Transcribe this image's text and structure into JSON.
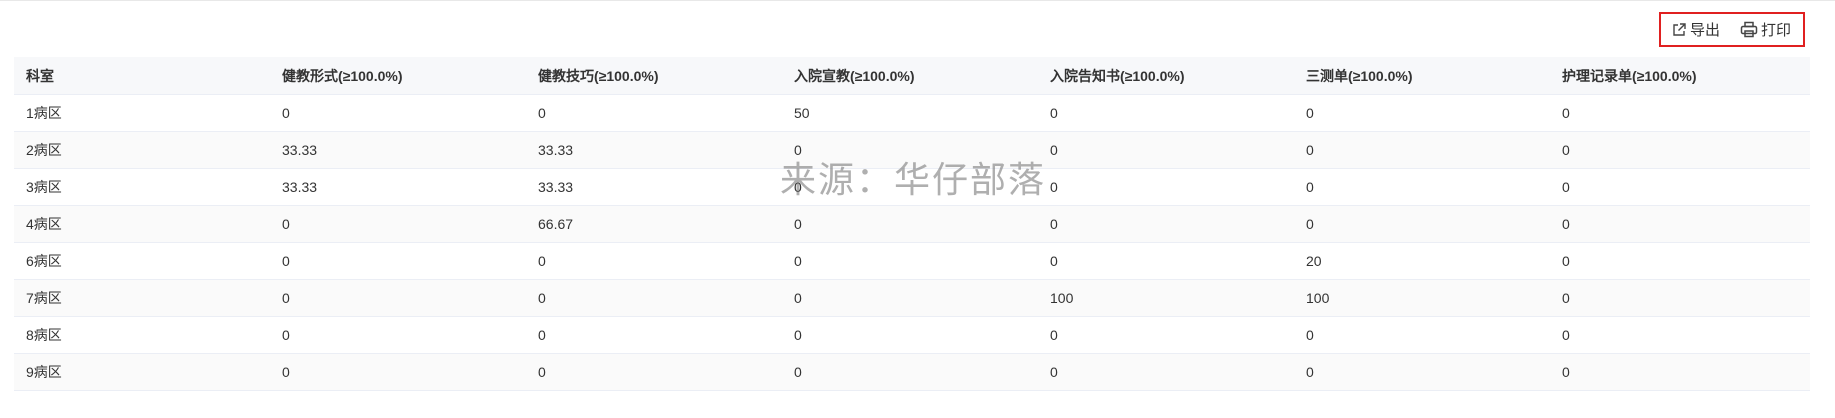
{
  "toolbar": {
    "export_label": "导出",
    "print_label": "打印",
    "export_icon": "external-link-icon",
    "print_icon": "printer-icon",
    "highlight_color": "#e02020"
  },
  "table": {
    "columns": [
      "科室",
      "健教形式(≥100.0%)",
      "健教技巧(≥100.0%)",
      "入院宣教(≥100.0%)",
      "入院告知书(≥100.0%)",
      "三测单(≥100.0%)",
      "护理记录单(≥100.0%)"
    ],
    "rows": [
      [
        "1病区",
        "0",
        "0",
        "50",
        "0",
        "0",
        "0"
      ],
      [
        "2病区",
        "33.33",
        "33.33",
        "0",
        "0",
        "0",
        "0"
      ],
      [
        "3病区",
        "33.33",
        "33.33",
        "0",
        "0",
        "0",
        "0"
      ],
      [
        "4病区",
        "0",
        "66.67",
        "0",
        "0",
        "0",
        "0"
      ],
      [
        "6病区",
        "0",
        "0",
        "0",
        "0",
        "20",
        "0"
      ],
      [
        "7病区",
        "0",
        "0",
        "0",
        "100",
        "100",
        "0"
      ],
      [
        "8病区",
        "0",
        "0",
        "0",
        "0",
        "0",
        "0"
      ],
      [
        "9病区",
        "0",
        "0",
        "0",
        "0",
        "0",
        "0"
      ]
    ]
  },
  "watermark": "来源：华仔部落"
}
